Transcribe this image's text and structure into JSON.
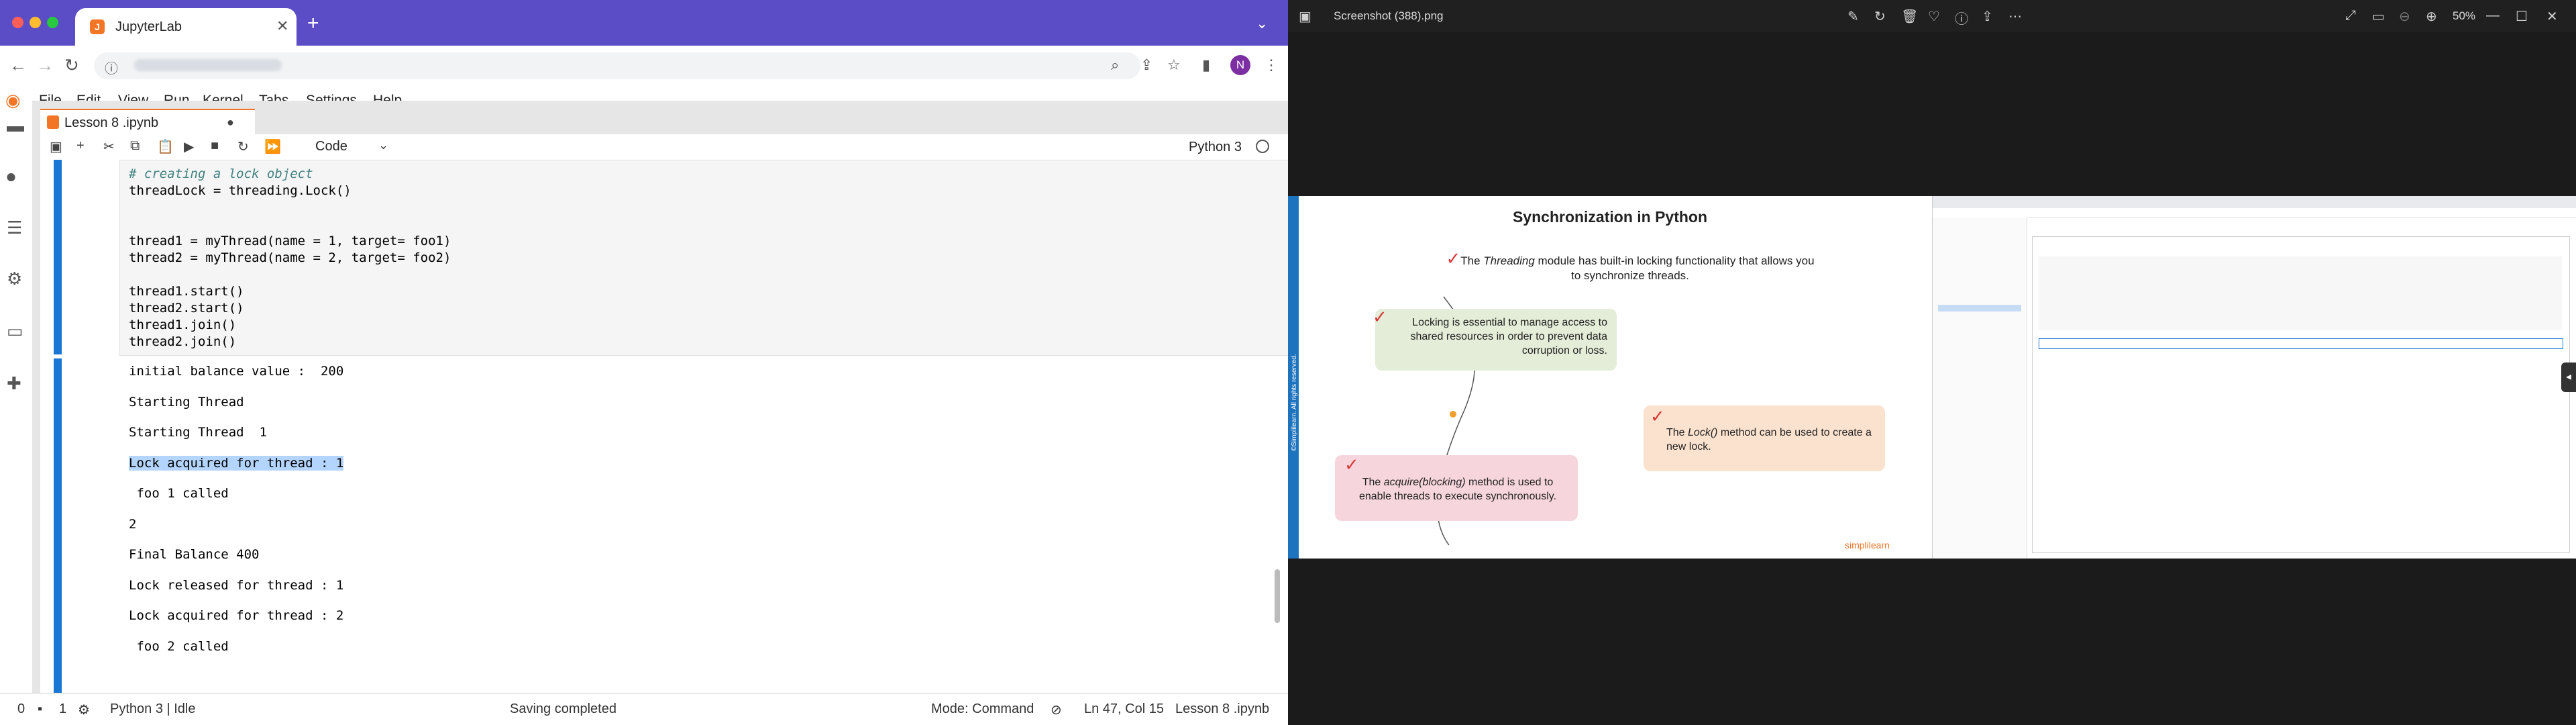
{
  "browser": {
    "tab_title": "JupyterLab",
    "avatar_letter": "N"
  },
  "menu": [
    "File",
    "Edit",
    "View",
    "Run",
    "Kernel",
    "Tabs",
    "Settings",
    "Help"
  ],
  "document_tab": {
    "name": "Lesson 8 .ipynb",
    "modified_marker": "●"
  },
  "toolbar": {
    "cell_type": "Code",
    "kernel": "Python 3"
  },
  "code_lines": [
    {
      "text": "# creating a lock object",
      "comment": true
    },
    {
      "text": "threadLock = threading.Lock()",
      "comment": false
    },
    {
      "text": "",
      "comment": false
    },
    {
      "text": "",
      "comment": false
    },
    {
      "text": "thread1 = myThread(name = 1, target= foo1)",
      "comment": false
    },
    {
      "text": "thread2 = myThread(name = 2, target= foo2)",
      "comment": false
    },
    {
      "text": "",
      "comment": false
    },
    {
      "text": "thread1.start()",
      "comment": false
    },
    {
      "text": "thread2.start()",
      "comment": false
    },
    {
      "text": "thread1.join()",
      "comment": false
    },
    {
      "text": "thread2.join()",
      "comment": false
    }
  ],
  "output_lines": [
    {
      "text": "initial balance value :  200",
      "selected": false
    },
    {
      "text": "Starting Thread",
      "selected": false
    },
    {
      "text": "Starting Thread  1",
      "selected": false
    },
    {
      "text": "Lock acquired for thread : 1",
      "selected": true
    },
    {
      "text": " foo 1 called",
      "selected": false
    },
    {
      "text": "2",
      "selected": false
    },
    {
      "text": "Final Balance 400",
      "selected": false
    },
    {
      "text": "Lock released for thread : 1",
      "selected": false
    },
    {
      "text": "Lock acquired for thread : 2",
      "selected": false
    },
    {
      "text": " foo 2 called",
      "selected": false
    }
  ],
  "statusbar": {
    "left_count_a": "0",
    "left_count_b": "1",
    "kernel_status": "Python 3 | Idle",
    "save_status": "Saving completed",
    "mode": "Mode: Command",
    "cursor": "Ln 47, Col 15",
    "file": "Lesson 8 .ipynb"
  },
  "viewer": {
    "title": "Screenshot (388).png",
    "zoom": "50%"
  },
  "slide": {
    "title": "Synchronization in Python",
    "intro_pre": "The ",
    "intro_em": "Threading",
    "intro_post": " module has built-in locking functionality that allows you to synchronize threads.",
    "card_lock": "Locking is essential to manage access to shared resources in order to prevent data corruption or loss.",
    "card_method_pre": "The ",
    "card_method_em": "Lock()",
    "card_method_post": " method can be used to create a new lock.",
    "card_acquire_pre": "The ",
    "card_acquire_em": "acquire(blocking)",
    "card_acquire_post": " method is used to enable threads to execute synchronously.",
    "brand": "simplilearn",
    "side_text": "©Simplilearn. All rights reserved."
  },
  "colors": {
    "browser_frame": "#5b4dc6",
    "jupyter_orange": "#f37626",
    "cell_active": "#1976d2",
    "selection": "#b3d4fc",
    "card_green": "#e3edd7",
    "card_orange": "#fbe2cf",
    "card_pink": "#f6d6dc"
  }
}
